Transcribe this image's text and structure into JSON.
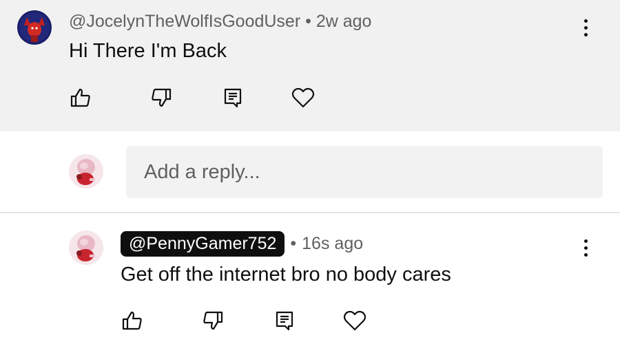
{
  "top_comment": {
    "handle": "@JocelynTheWolfIsGoodUser",
    "separator": "•",
    "time": "2w ago",
    "text": "Hi There I'm Back",
    "actions": [
      "like-icon",
      "dislike-icon",
      "reply-icon",
      "heart-icon"
    ]
  },
  "reply_box": {
    "placeholder": "Add a reply..."
  },
  "reply_comment": {
    "handle": "@PennyGamer752",
    "separator": "•",
    "time": "16s ago",
    "text": "Get off the internet bro no body cares",
    "actions": [
      "like-icon",
      "dislike-icon",
      "reply-icon",
      "heart-icon"
    ]
  },
  "colors": {
    "top_comment_bg": "#f1f1f1",
    "secondary_text": "#606060",
    "primary_text": "#0f0f0f",
    "handle_highlight_bg": "#0f0f0f"
  }
}
